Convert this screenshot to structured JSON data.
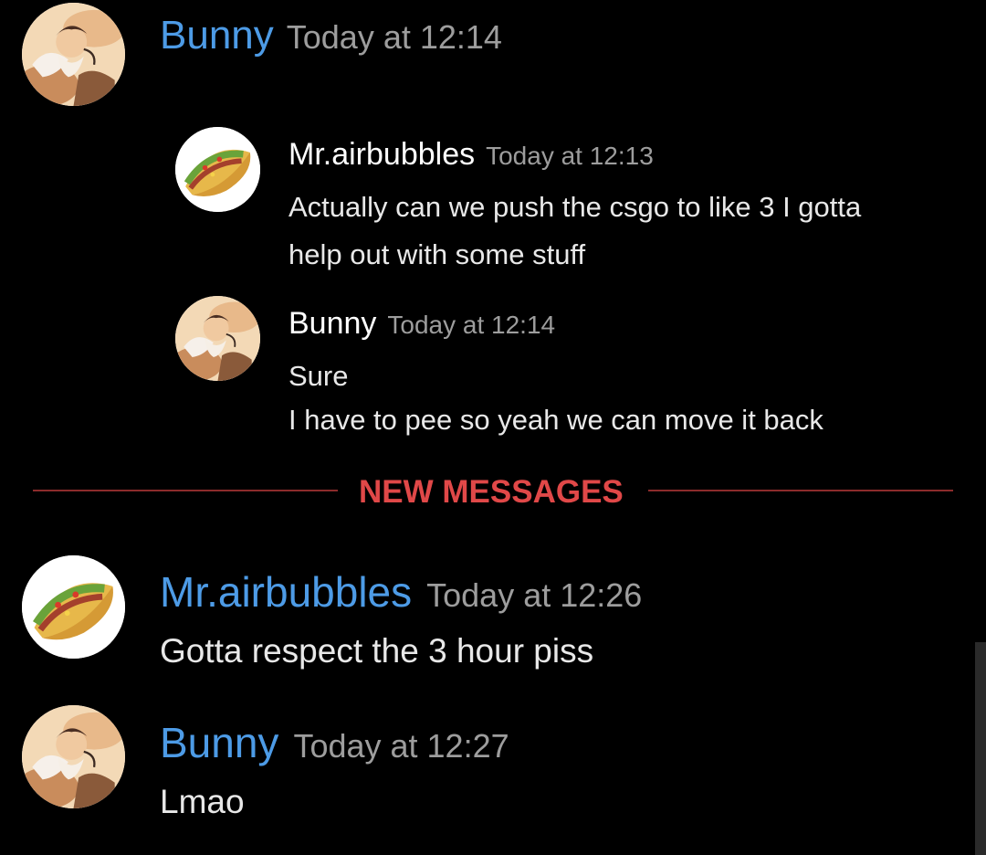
{
  "messages": [
    {
      "author": "Bunny",
      "time": "Today at 12:14",
      "avatar_icon": "bunny-avatar-icon",
      "quoted": [
        {
          "author": "Mr.airbubbles",
          "time": "Today at 12:13",
          "avatar_icon": "taco-avatar-icon",
          "lines": [
            "Actually can we push the csgo to like 3 I gotta",
            "help out with some stuff"
          ]
        },
        {
          "author": "Bunny",
          "time": "Today at 12:14",
          "avatar_icon": "bunny-avatar-icon",
          "lines": [
            "Sure",
            "I have to pee so yeah we can move it back"
          ]
        }
      ]
    },
    {
      "author": "Mr.airbubbles",
      "time": "Today at 12:26",
      "avatar_icon": "taco-avatar-icon",
      "text": "Gotta respect the 3 hour piss"
    },
    {
      "author": "Bunny",
      "time": "Today at 12:27",
      "avatar_icon": "bunny-avatar-icon",
      "text": "Lmao"
    }
  ],
  "divider": {
    "label": "NEW MESSAGES"
  },
  "colors": {
    "background": "#000000",
    "author_link": "#4d9be6",
    "timestamp": "#9d9d9d",
    "new_messages": "#e04848"
  }
}
